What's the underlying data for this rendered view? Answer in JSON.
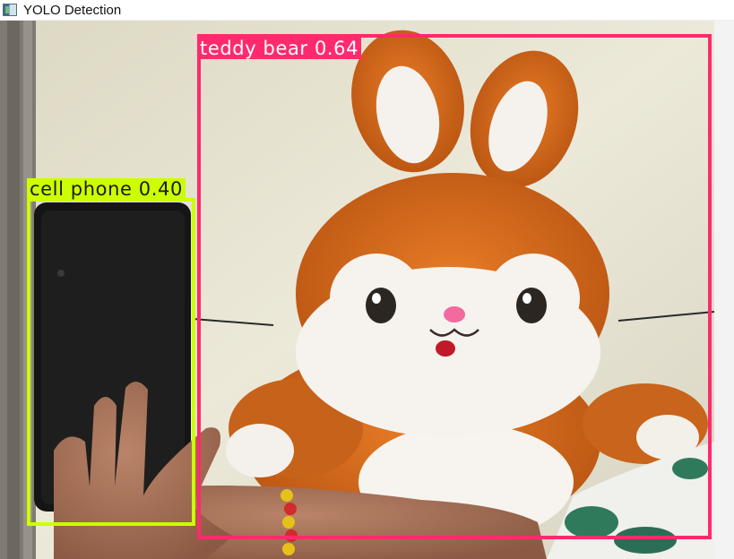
{
  "window": {
    "title": "YOLO Detection",
    "icon": "app-icon"
  },
  "detections": [
    {
      "label": "teddy bear",
      "confidence": "0.64",
      "caption": "teddy bear 0.64",
      "color": "#ff2a6d"
    },
    {
      "label": "cell phone",
      "confidence": "0.40",
      "caption": "cell phone 0.40",
      "color": "#ccff00"
    }
  ]
}
